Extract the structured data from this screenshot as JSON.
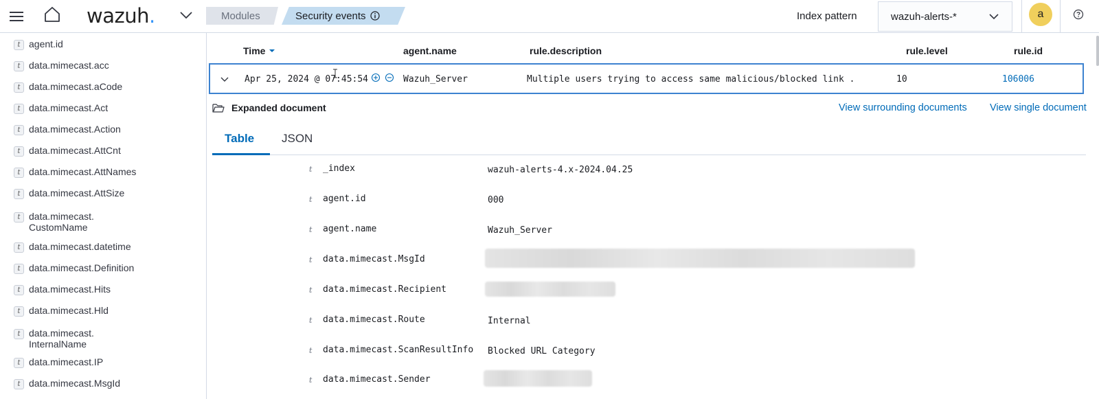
{
  "header": {
    "logo_text": "wazuh",
    "logo_dot": ".",
    "breadcrumbs": [
      "Modules",
      "Security events"
    ],
    "index_pattern_label": "Index pattern",
    "index_pattern_value": "wazuh-alerts-*",
    "avatar_letter": "a"
  },
  "sidebar": {
    "fields": [
      {
        "type": "t",
        "name": "agent.id"
      },
      {
        "type": "t",
        "name": "data.mimecast.acc"
      },
      {
        "type": "t",
        "name": "data.mimecast.aCode"
      },
      {
        "type": "t",
        "name": "data.mimecast.Act"
      },
      {
        "type": "t",
        "name": "data.mimecast.Action"
      },
      {
        "type": "t",
        "name": "data.mimecast.AttCnt"
      },
      {
        "type": "t",
        "name": "data.mimecast.AttNames"
      },
      {
        "type": "t",
        "name": "data.mimecast.AttSize"
      },
      {
        "type": "t",
        "name": "data.mimecast.\nCustomName"
      },
      {
        "type": "t",
        "name": "data.mimecast.datetime"
      },
      {
        "type": "t",
        "name": "data.mimecast.Definition"
      },
      {
        "type": "t",
        "name": "data.mimecast.Hits"
      },
      {
        "type": "t",
        "name": "data.mimecast.Hld"
      },
      {
        "type": "t",
        "name": "data.mimecast.\nInternalName"
      },
      {
        "type": "t",
        "name": "data.mimecast.IP"
      },
      {
        "type": "t",
        "name": "data.mimecast.MsgId"
      }
    ]
  },
  "table": {
    "columns": [
      "Time",
      "agent.name",
      "rule.description",
      "rule.level",
      "rule.id"
    ],
    "row": {
      "time": "Apr 25, 2024 @ 07:45:54",
      "agent_name": "Wazuh_Server",
      "rule_description": "Multiple users trying to access same malicious/blocked link .",
      "rule_level": "10",
      "rule_id": "106006"
    }
  },
  "expanded": {
    "title": "Expanded document",
    "link_surrounding": "View surrounding documents",
    "link_single": "View single document",
    "tabs": [
      "Table",
      "JSON"
    ],
    "fields": [
      {
        "type": "t",
        "key": "_index",
        "value": "wazuh-alerts-4.x-2024.04.25"
      },
      {
        "type": "t",
        "key": "agent.id",
        "value": "000"
      },
      {
        "type": "t",
        "key": "agent.name",
        "value": "Wazuh_Server"
      },
      {
        "type": "t",
        "key": "data.mimecast.MsgId",
        "value": ""
      },
      {
        "type": "t",
        "key": "data.mimecast.Recipient",
        "value": ""
      },
      {
        "type": "t",
        "key": "data.mimecast.Route",
        "value": "Internal"
      },
      {
        "type": "t",
        "key": "data.mimecast.ScanResultInfo",
        "value": "Blocked URL Category"
      },
      {
        "type": "t",
        "key": "data.mimecast.Sender",
        "value": ""
      }
    ]
  },
  "colors": {
    "accent": "#006bb8",
    "row_border": "#3c82d0",
    "avatar": "#f0cf5c",
    "logo_dot": "#3595f9"
  }
}
